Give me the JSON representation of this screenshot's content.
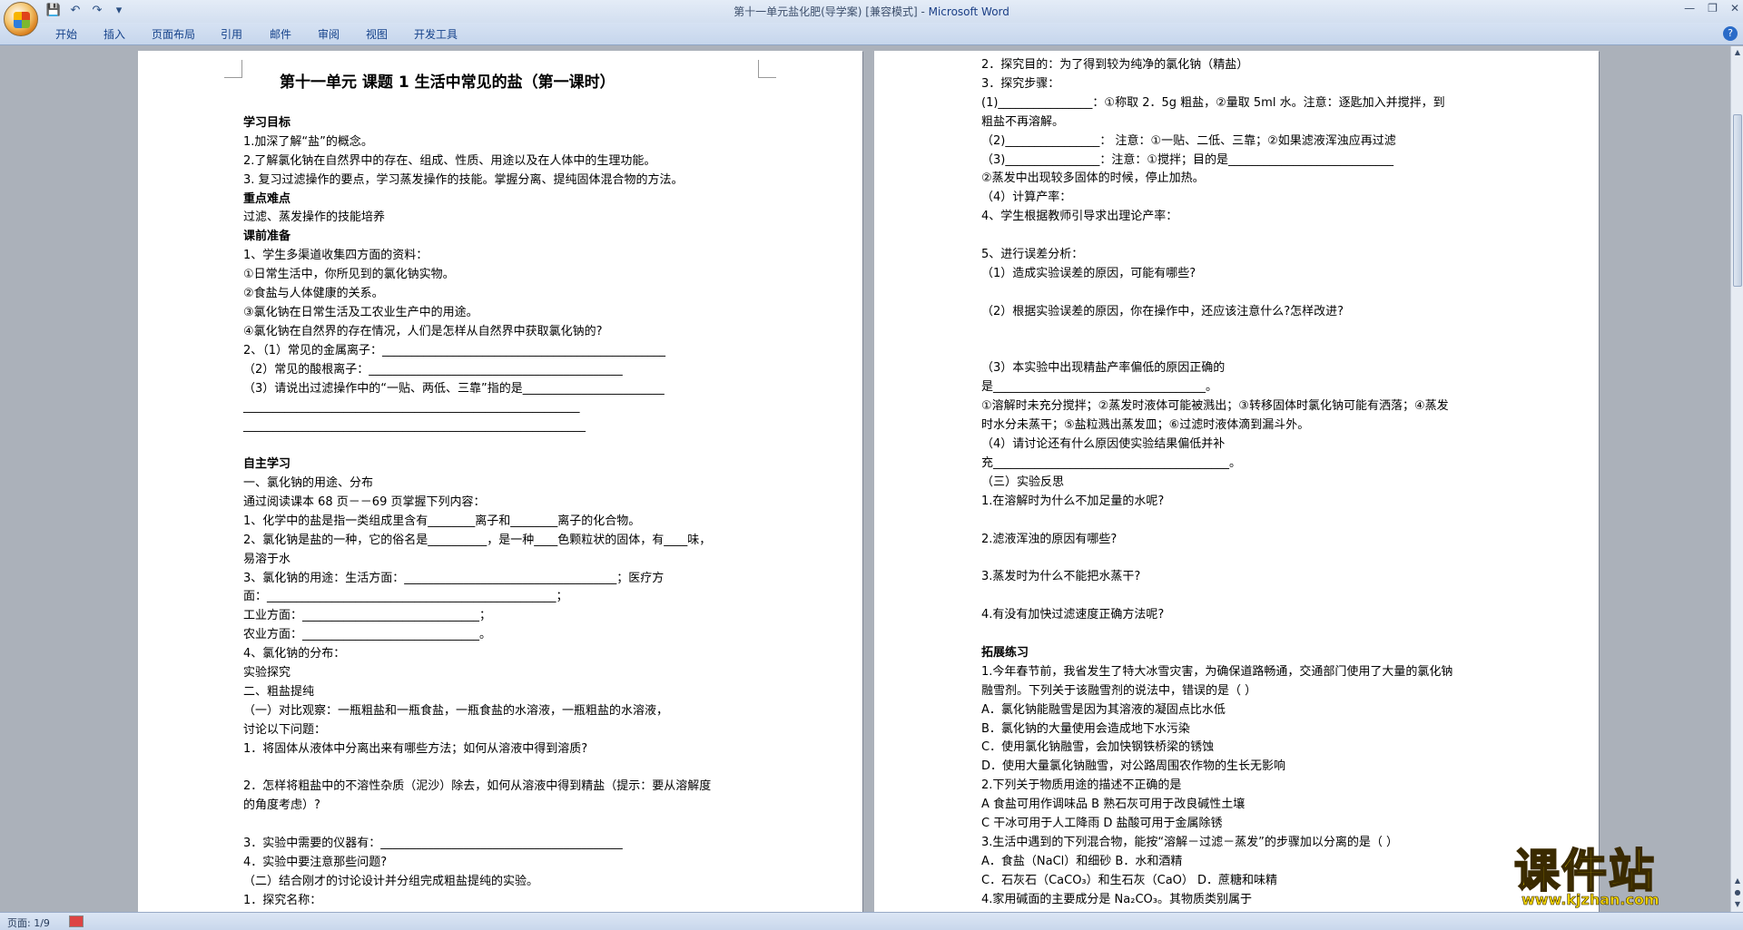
{
  "window": {
    "title": "第十一单元盐化肥(导学案) [兼容模式]",
    "title_sep": " - ",
    "app_name": "Microsoft Word"
  },
  "qat": {
    "save": "💾",
    "undo": "↶",
    "redo": "↷",
    "customize": "▾"
  },
  "win_ctrl": {
    "minimize": "—",
    "maximize": "❐",
    "close": "✕"
  },
  "ribbon": {
    "tabs": [
      "开始",
      "插入",
      "页面布局",
      "引用",
      "邮件",
      "审阅",
      "视图",
      "开发工具"
    ],
    "help": "?"
  },
  "status": {
    "page": "页面: 1/9"
  },
  "watermark": {
    "brand": "课件站",
    "url": "www.kjzhan.com"
  },
  "page1": {
    "title": "第十一单元  课题 1      生活中常见的盐（第一课时）",
    "lines": [
      "",
      "学习目标",
      "1.加深了解“盐”的概念。",
      "2.了解氯化钠在自然界中的存在、组成、性质、用途以及在人体中的生理功能。",
      "3. 复习过滤操作的要点，学习蒸发操作的技能。掌握分离、提纯固体混合物的方法。",
      "重点难点",
      "过滤、蒸发操作的技能培养",
      "课前准备",
      "1、学生多渠道收集四方面的资料：",
      "①日常生活中，你所见到的氯化钠实物。",
      "②食盐与人体健康的关系。",
      "③氯化钠在日常生活及工农业生产中的用途。",
      "④氯化钠在自然界的存在情况，人们是怎样从自然界中获取氯化钠的?",
      "2、（1）常见的金属离子：________________________________________________",
      "（2）常见的酸根离子：___________________________________________",
      "（3）请说出过滤操作中的“一贴、两低、三靠”指的是________________________",
      "_________________________________________________________",
      "__________________________________________________________",
      "",
      "自主学习",
      "一、氯化钠的用途、分布",
      "通过阅读课本 68 页－－69 页掌握下列内容：",
      "1、化学中的盐是指一类组成里含有________离子和________离子的化合物。",
      "2、氯化钠是盐的一种，它的俗名是__________，是一种____色颗粒状的固体，有____味，",
      "易溶于水",
      "3、氯化钠的用途：生活方面：____________________________________；医疗方",
      "面：_________________________________________________；",
      "工业方面：______________________________；",
      "农业方面：______________________________。",
      "4、氯化钠的分布：",
      "实验探究",
      "二、粗盐提纯",
      "（一）对比观察：一瓶粗盐和一瓶食盐，一瓶食盐的水溶液，一瓶粗盐的水溶液，",
      "讨论以下问题：",
      "1．将固体从液体中分离出来有哪些方法；如何从溶液中得到溶质?",
      "",
      "2．怎样将粗盐中的不溶性杂质（泥沙）除去，如何从溶液中得到精盐（提示：要从溶解度",
      "的角度考虑）?",
      "",
      "3．实验中需要的仪器有：_________________________________________",
      "4．实验中要注意那些问题?",
      "（二）结合刚才的讨论设计并分组完成粗盐提纯的实验。",
      "1．探究名称："
    ]
  },
  "page2": {
    "lines": [
      "2．探究目的：为了得到较为纯净的氯化钠（精盐）",
      "3．探究步骤：",
      "  (1)________________：①称取 2．5g 粗盐，②量取 5ml 水。注意：逐匙加入并搅拌，到",
      "粗盐不再溶解。",
      "（2)________________： 注意：①一贴、二低、三靠；②如果滤液浑浊应再过滤",
      "（3)________________：注意：①搅拌；目的是____________________________",
      "②蒸发中出现较多固体的时候，停止加热。",
      "（4）计算产率：",
      "4、学生根据教师引导求出理论产率：",
      "",
      "5、进行误差分析：",
      "（1）造成实验误差的原因，可能有哪些?",
      "",
      "（2）根据实验误差的原因，你在操作中，还应该注意什么?怎样改进?",
      "",
      "",
      "（3）本实验中出现精盐产率偏低的原因正确的",
      "是____________________________________。",
      "①溶解时未充分搅拌；②蒸发时液体可能被溅出；③转移固体时氯化钠可能有洒落；④蒸发",
      "时水分未蒸干；⑤盐粒溅出蒸发皿；⑥过滤时液体滴到漏斗外。",
      "（4）请讨论还有什么原因使实验结果偏低并补",
      "充________________________________________。",
      "（三）实验反思",
      "1.在溶解时为什么不加足量的水呢?",
      "",
      "2.滤液浑浊的原因有哪些?",
      "",
      "3.蒸发时为什么不能把水蒸干?",
      "",
      "4.有没有加快过滤速度正确方法呢?",
      "",
      "拓展练习",
      "1.今年春节前，我省发生了特大冰雪灾害，为确保道路畅通，交通部门使用了大量的氯化钠",
      "    融雪剂。下列关于该融雪剂的说法中，错误的是（      ）",
      " A．氯化钠能融雪是因为其溶液的凝固点比水低",
      " B．氯化钠的大量使用会造成地下水污染",
      " C．使用氯化钠融雪，会加快钢铁桥梁的锈蚀",
      " D．使用大量氯化钠融雪，对公路周围农作物的生长无影响",
      "2.下列关于物质用途的描述不正确的是",
      " A 食盐可用作调味品                B 熟石灰可用于改良碱性土壤",
      " C 干冰可用于人工降雨              D 盐酸可用于金属除锈",
      "3.生活中遇到的下列混合物，能按“溶解－过滤－蒸发”的步骤加以分离的是（   ）",
      " A．食盐（NaCl）和细砂              B．水和酒精",
      " C．石灰石（CaCO₃）和生石灰（CaO）     D．蔗糖和味精",
      "4.家用碱面的主要成分是 Na₂CO₃。其物质类别属于"
    ]
  }
}
